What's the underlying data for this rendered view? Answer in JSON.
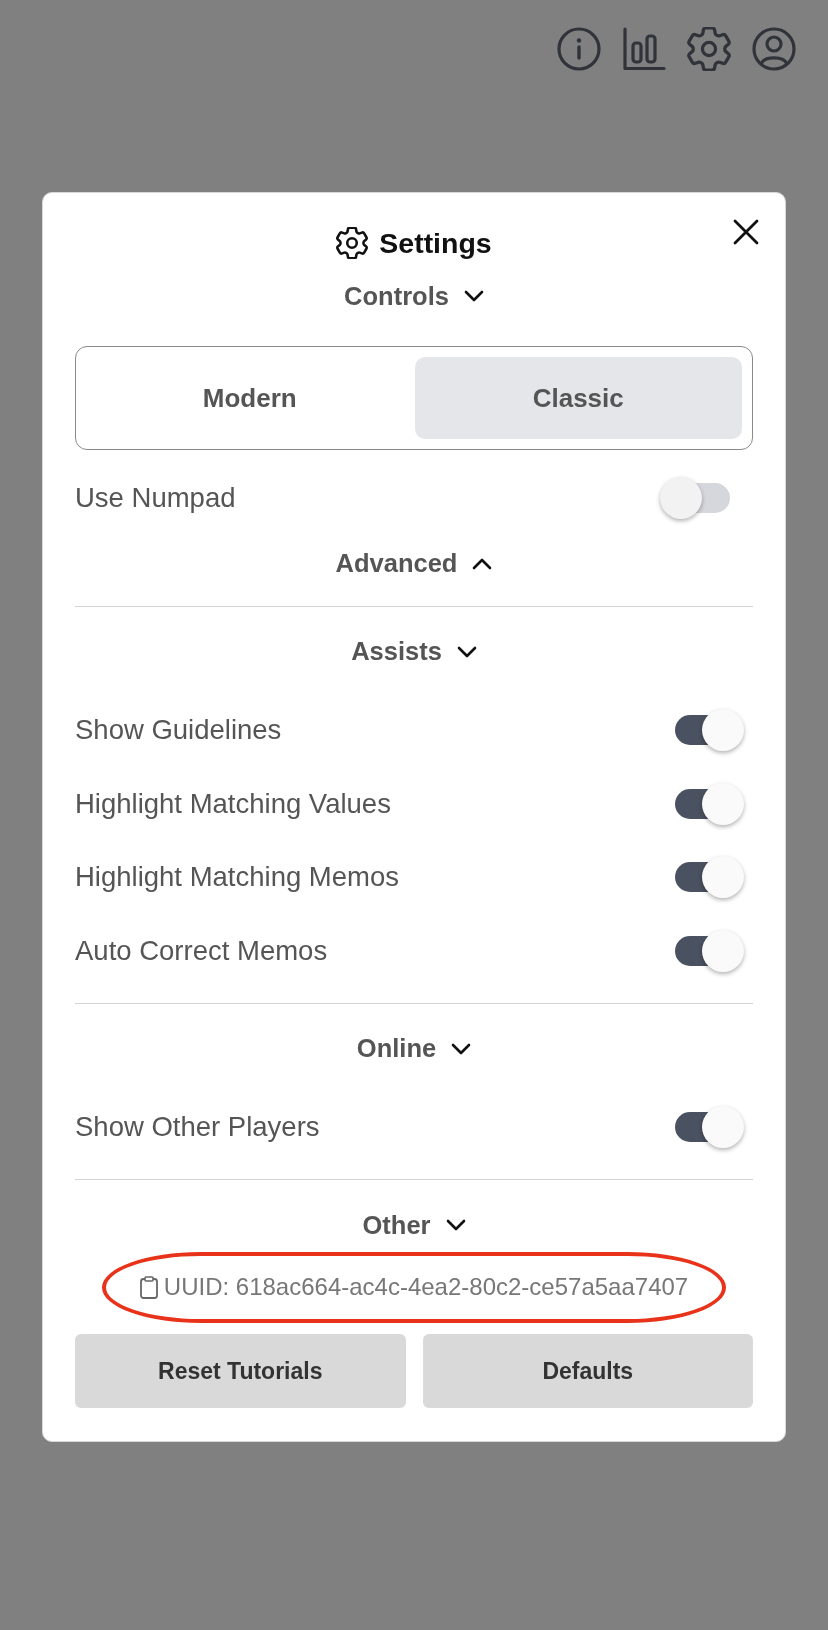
{
  "dialog": {
    "title": "Settings",
    "rows": [
      {
        "kind": "heading",
        "label": "Controls",
        "expanded": false
      },
      {
        "kind": "segmented",
        "options": [
          {
            "label": "Modern",
            "selected": false
          },
          {
            "label": "Classic",
            "selected": true
          }
        ]
      },
      {
        "kind": "toggle",
        "label": "Use Numpad",
        "on": false
      },
      {
        "kind": "heading",
        "label": "Advanced",
        "expanded": true
      },
      {
        "kind": "divider"
      },
      {
        "kind": "heading",
        "label": "Assists",
        "expanded": false
      },
      {
        "kind": "toggle",
        "label": "Show Guidelines",
        "on": true
      },
      {
        "kind": "toggle",
        "label": "Highlight Matching Values",
        "on": true
      },
      {
        "kind": "toggle",
        "label": "Highlight Matching Memos",
        "on": true
      },
      {
        "kind": "toggle",
        "label": "Auto Correct Memos",
        "on": true
      },
      {
        "kind": "divider"
      },
      {
        "kind": "heading",
        "label": "Online",
        "expanded": false
      },
      {
        "kind": "toggle",
        "label": "Show Other Players",
        "on": true
      },
      {
        "kind": "divider"
      },
      {
        "kind": "heading",
        "label": "Other",
        "expanded": false
      },
      {
        "kind": "uuid",
        "text": "UUID: 618ac664-ac4c-4ea2-80c2-ce57a5aa7407",
        "circled": true
      },
      {
        "kind": "buttons",
        "buttons": [
          "Reset Tutorials",
          "Defaults"
        ]
      }
    ]
  }
}
